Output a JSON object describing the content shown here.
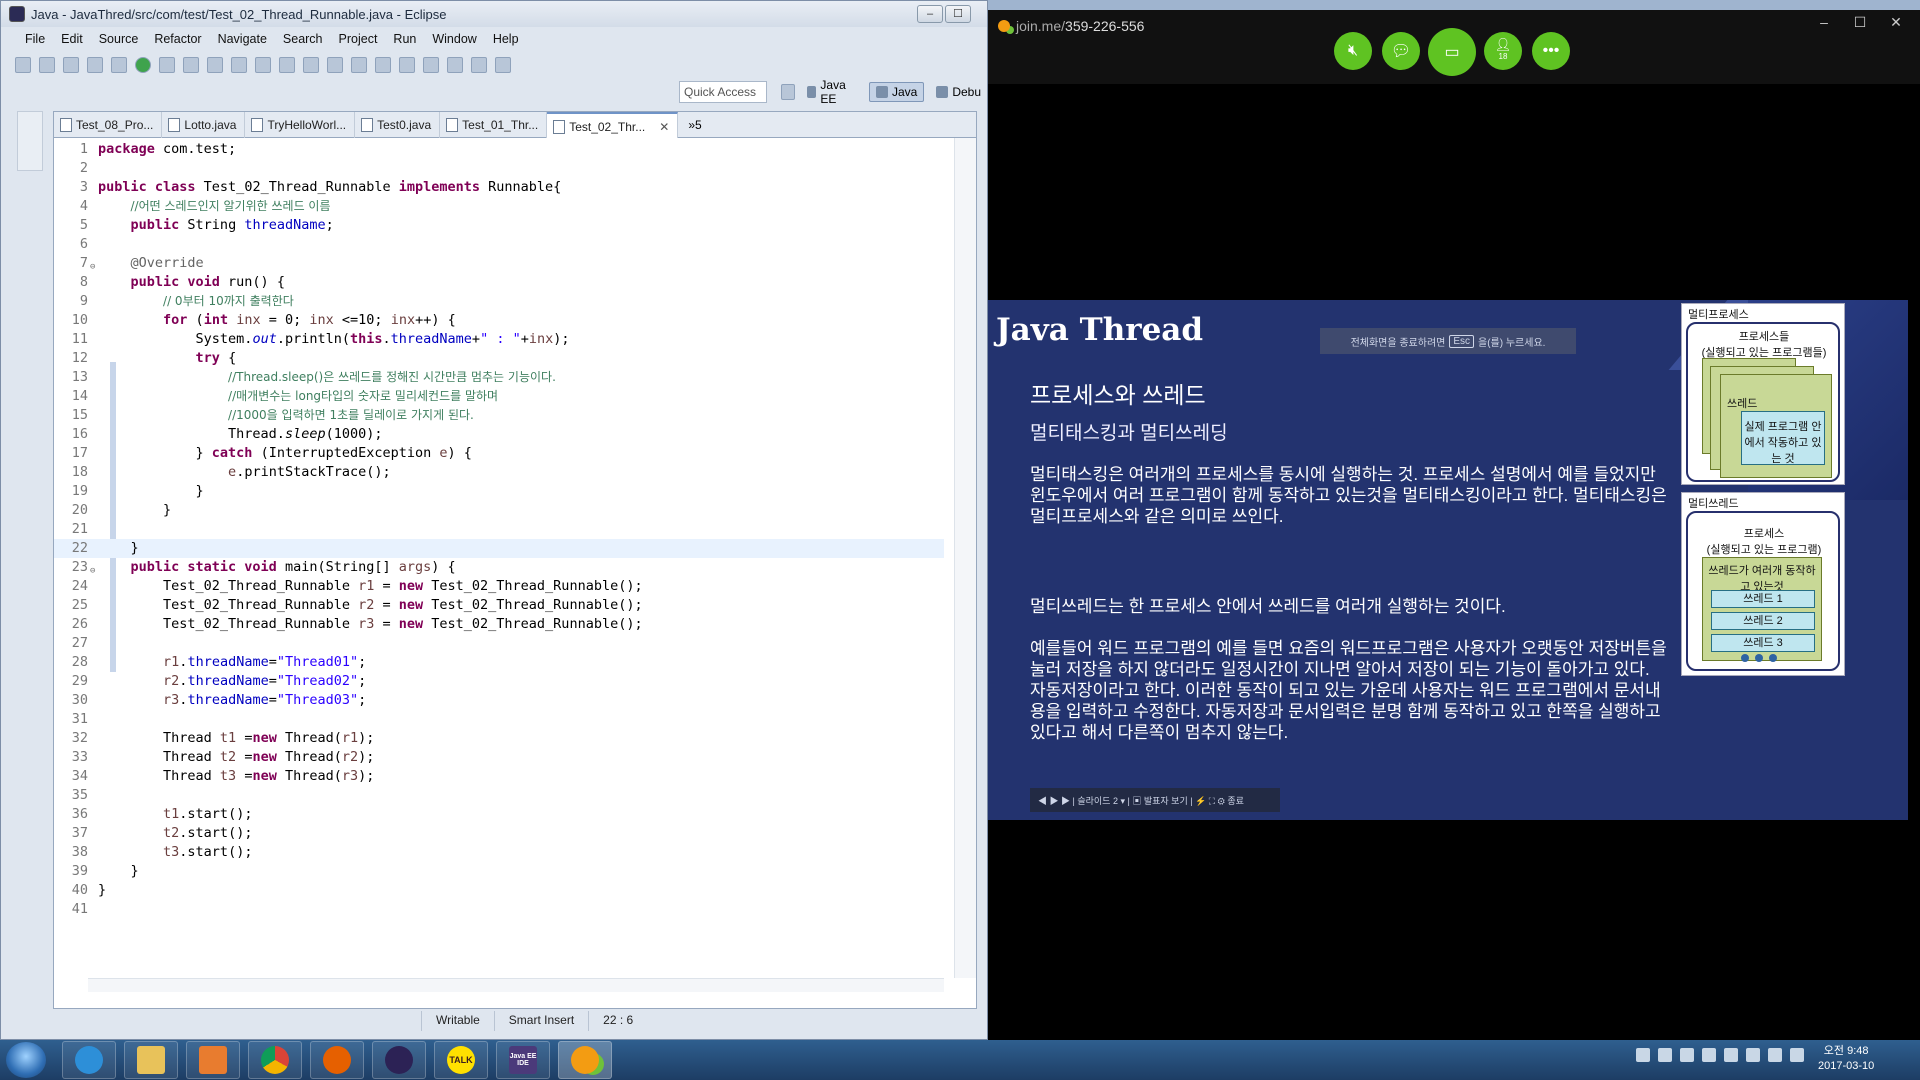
{
  "eclipse": {
    "title": "Java - JavaThred/src/com/test/Test_02_Thread_Runnable.java - Eclipse",
    "menu": [
      "File",
      "Edit",
      "Source",
      "Refactor",
      "Navigate",
      "Search",
      "Project",
      "Run",
      "Window",
      "Help"
    ],
    "quick_access": "Quick Access",
    "perspectives": [
      "Java EE",
      "Java",
      "Debu"
    ],
    "tabs": [
      "Test_08_Pro...",
      "Lotto.java",
      "TryHelloWorl...",
      "Test0.java",
      "Test_01_Thr...",
      "Test_02_Thr..."
    ],
    "tab_overflow": "»5",
    "status": {
      "writable": "Writable",
      "insert": "Smart Insert",
      "position": "22 : 6"
    }
  },
  "code": {
    "numbers": [
      "1",
      "2",
      "3",
      "4",
      "5",
      "6",
      "7",
      "8",
      "9",
      "10",
      "11",
      "12",
      "13",
      "14",
      "15",
      "16",
      "17",
      "18",
      "19",
      "20",
      "21",
      "22",
      "23",
      "24",
      "25",
      "26",
      "27",
      "28",
      "29",
      "30",
      "31",
      "32",
      "33",
      "34",
      "35",
      "36",
      "37",
      "38",
      "39",
      "40",
      "41"
    ]
  },
  "joinme": {
    "url_host": "join.me/",
    "url_code": "359-226-556",
    "buttons": [
      "mute-icon",
      "chat-icon",
      "screen-icon",
      "participants-icon",
      "more-icon"
    ],
    "participant_count": "18",
    "window": {
      "minimize": "–",
      "maximize": "☐",
      "close": "✕"
    }
  },
  "slide": {
    "title": "Java Thread",
    "esc_hint_pre": "전체화면을 종료하려면",
    "esc_key": "Esc",
    "esc_hint_post": "을(를) 누르세요.",
    "h1": "프로세스와 쓰레드",
    "h2": "멀티태스킹과 멀티쓰레딩",
    "p1": "멀티태스킹은 여러개의 프로세스를 동시에 실행하는 것. 프로세스 설명에서 예를 들었지만 윈도우에서 여러 프로그램이 함께 동작하고 있는것을 멀티태스킹이라고 한다. 멀티태스킹은 멀티프로세스와 같은 의미로 쓰인다.",
    "p2": "멀티쓰레드는 한 프로세스 안에서 쓰레드를 여러개 실행하는 것이다.",
    "p3": "예를들어 워드 프로그램의 예를 들면 요즘의 워드프로그램은 사용자가 오랫동안 저장버튼을 눌러 저장을 하지 않더라도 일정시간이 지나면 알아서 저장이 되는 기능이 돌아가고 있다. 자동저장이라고 한다. 이러한 동작이 되고 있는 가운데 사용자는 워드 프로그램에서 문서내용을 입력하고 수정한다. 자동저장과 문서입력은 분명 함께 동작하고 있고 한쪽을 실행하고 있다고 해서 다른쪽이 멈추지 않는다.",
    "controls": "◀ ▶ ▶ | 슬라이드 2 ▾ | ▣ 발표자 보기 | ⚡ ⛶ ⚙ 종료",
    "diagram1": {
      "title": "멀티프로세스",
      "process_label": "프로세스들\n(실행되고 있는 프로그램들)",
      "thread_label": "쓰레드",
      "inner_label": "실제 프로그램 안에서 작동하고 있는 것"
    },
    "diagram2": {
      "title": "멀티쓰레드",
      "process_label": "프로세스\n(실행되고 있는 프로그램)",
      "group_label": "쓰레드가 여러개 동작하고 있는것",
      "threads": [
        "쓰레드 1",
        "쓰레드 2",
        "쓰레드 3"
      ]
    }
  },
  "taskbar": {
    "apps": [
      "ie-icon",
      "explorer-icon",
      "media-icon",
      "chrome-icon",
      "firefox-icon",
      "eclipse-icon",
      "kakaotalk-icon",
      "javaee-ide-icon",
      "joinme-icon"
    ],
    "kakao_label": "TALK",
    "javaee_label": "Java EE IDE",
    "time": "오전 9:48",
    "date": "2017-03-10"
  }
}
